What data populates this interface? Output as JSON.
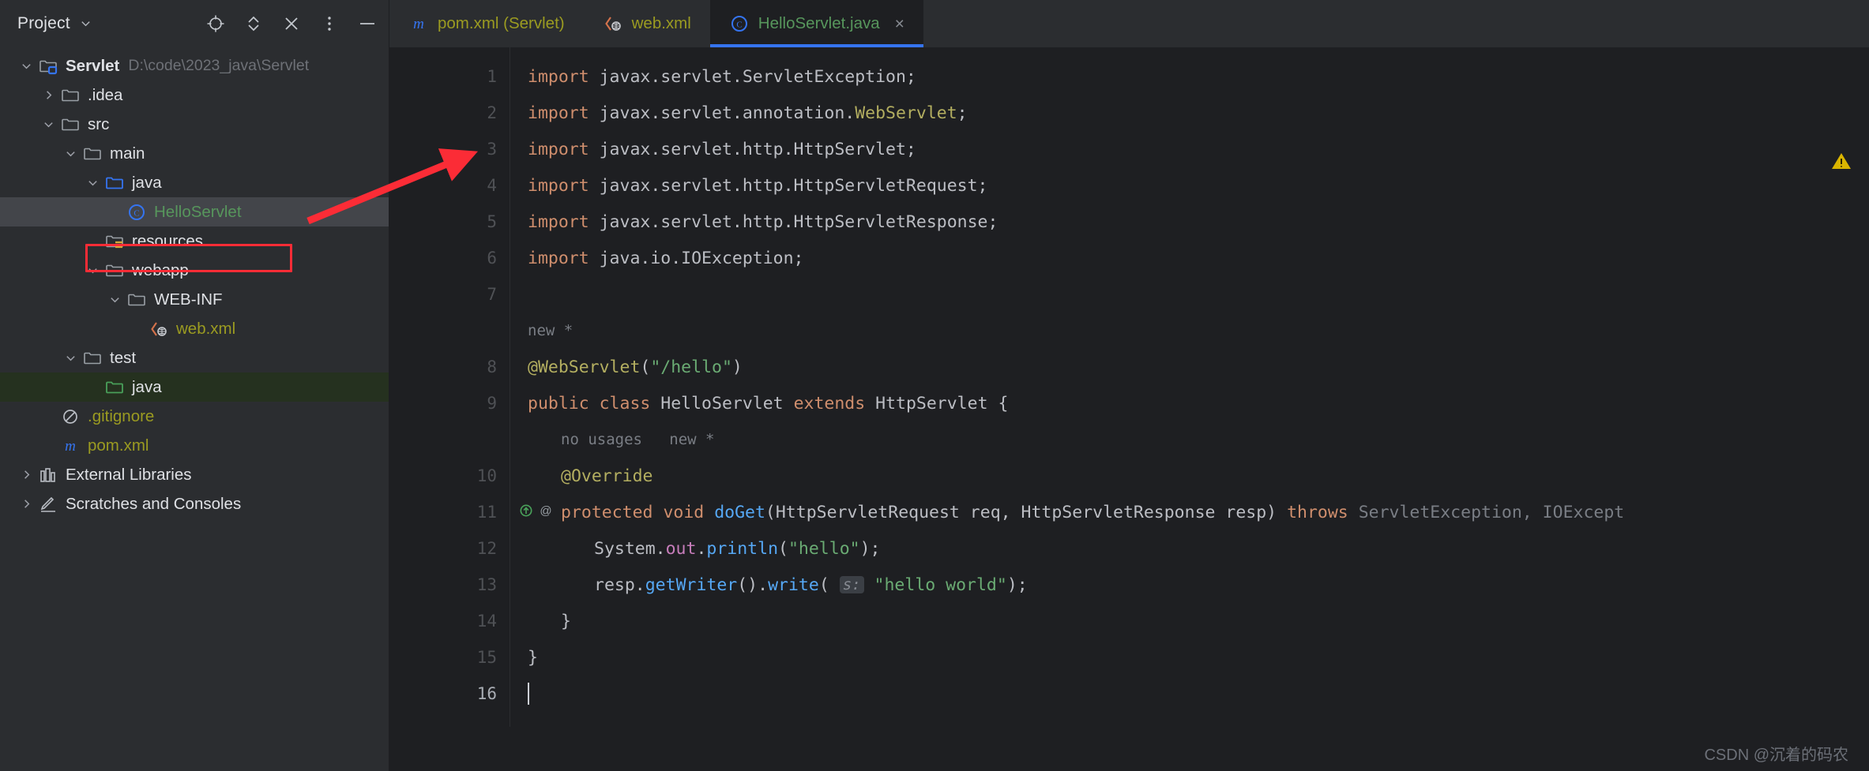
{
  "panel": {
    "title": "Project",
    "tools": [
      "locate-icon",
      "expand-collapse-icon",
      "close-icon",
      "more-options-icon",
      "minimize-icon"
    ]
  },
  "tree": [
    {
      "label": "Servlet",
      "path": "D:\\code\\2023_java\\Servlet",
      "icon": "module-folder-icon",
      "arrow": "down",
      "indent": 0,
      "bold": true,
      "color": "default"
    },
    {
      "label": ".idea",
      "path": "",
      "icon": "folder-icon",
      "arrow": "right",
      "indent": 1,
      "bold": false,
      "color": "default"
    },
    {
      "label": "src",
      "path": "",
      "icon": "folder-icon",
      "arrow": "down",
      "indent": 1,
      "bold": false,
      "color": "default"
    },
    {
      "label": "main",
      "path": "",
      "icon": "folder-icon",
      "arrow": "down",
      "indent": 2,
      "bold": false,
      "color": "default"
    },
    {
      "label": "java",
      "path": "",
      "icon": "source-root-folder-icon",
      "arrow": "down",
      "indent": 3,
      "bold": false,
      "color": "default"
    },
    {
      "label": "HelloServlet",
      "path": "",
      "icon": "java-class-icon",
      "arrow": "none",
      "indent": 4,
      "bold": false,
      "color": "green",
      "selected": true,
      "annotated": true
    },
    {
      "label": "resources",
      "path": "",
      "icon": "resources-folder-icon",
      "arrow": "none",
      "indent": 3,
      "bold": false,
      "color": "default"
    },
    {
      "label": "webapp",
      "path": "",
      "icon": "folder-icon",
      "arrow": "down",
      "indent": 3,
      "bold": false,
      "color": "default"
    },
    {
      "label": "WEB-INF",
      "path": "",
      "icon": "folder-icon",
      "arrow": "down",
      "indent": 4,
      "bold": false,
      "color": "default"
    },
    {
      "label": "web.xml",
      "path": "",
      "icon": "xml-file-icon",
      "arrow": "none",
      "indent": 5,
      "bold": false,
      "color": "olive"
    },
    {
      "label": "test",
      "path": "",
      "icon": "folder-icon",
      "arrow": "down",
      "indent": 2,
      "bold": false,
      "color": "default"
    },
    {
      "label": "java",
      "path": "",
      "icon": "test-root-folder-icon",
      "arrow": "none",
      "indent": 3,
      "bold": false,
      "color": "default",
      "testroot": true
    },
    {
      "label": ".gitignore",
      "path": "",
      "icon": "gitignore-icon",
      "arrow": "none",
      "indent": 1,
      "bold": false,
      "color": "olive"
    },
    {
      "label": "pom.xml",
      "path": "",
      "icon": "maven-icon",
      "arrow": "none",
      "indent": 1,
      "bold": false,
      "color": "olive"
    },
    {
      "label": "External Libraries",
      "path": "",
      "icon": "library-icon",
      "arrow": "right",
      "indent": 0,
      "bold": false,
      "color": "default"
    },
    {
      "label": "Scratches and Consoles",
      "path": "",
      "icon": "scratches-icon",
      "arrow": "right",
      "indent": 0,
      "bold": false,
      "color": "default"
    }
  ],
  "tabs": [
    {
      "label": "pom.xml (Servlet)",
      "icon": "maven-icon",
      "type": "xml",
      "active": false,
      "closable": false
    },
    {
      "label": "web.xml",
      "icon": "xml-file-icon",
      "type": "xml",
      "active": false,
      "closable": false
    },
    {
      "label": "HelloServlet.java",
      "icon": "java-class-icon",
      "type": "java",
      "active": true,
      "closable": true,
      "close_label": "×"
    }
  ],
  "editor": {
    "line_numbers": [
      "1",
      "2",
      "3",
      "4",
      "5",
      "6",
      "7",
      "8",
      "9",
      "10",
      "11",
      "12",
      "13",
      "14",
      "15",
      "16"
    ],
    "current_line": "16",
    "gutter_icons": {
      "line": "11",
      "icons": [
        "override-method-icon",
        "annotation-icon"
      ]
    },
    "code_lines": [
      {
        "n": "1",
        "tokens": [
          {
            "c": "k",
            "t": "import "
          },
          {
            "c": "t",
            "t": "javax.servlet.ServletException;"
          }
        ]
      },
      {
        "n": "2",
        "tokens": [
          {
            "c": "k",
            "t": "import "
          },
          {
            "c": "t",
            "t": "javax.servlet.annotation."
          },
          {
            "c": "a",
            "t": "WebServlet"
          },
          {
            "c": "t",
            "t": ";"
          }
        ]
      },
      {
        "n": "3",
        "tokens": [
          {
            "c": "k",
            "t": "import "
          },
          {
            "c": "t",
            "t": "javax.servlet.http.HttpServlet;"
          }
        ]
      },
      {
        "n": "4",
        "tokens": [
          {
            "c": "k",
            "t": "import "
          },
          {
            "c": "t",
            "t": "javax.servlet.http.HttpServletRequest;"
          }
        ]
      },
      {
        "n": "5",
        "tokens": [
          {
            "c": "k",
            "t": "import "
          },
          {
            "c": "t",
            "t": "javax.servlet.http.HttpServletResponse;"
          }
        ]
      },
      {
        "n": "6",
        "tokens": [
          {
            "c": "k",
            "t": "import "
          },
          {
            "c": "t",
            "t": "java.io.IOException;"
          }
        ]
      },
      {
        "n": "7",
        "tokens": []
      },
      {
        "n": "",
        "hint": true,
        "tokens": [
          {
            "c": "dim",
            "t": "new *"
          }
        ]
      },
      {
        "n": "8",
        "tokens": [
          {
            "c": "a",
            "t": "@WebServlet"
          },
          {
            "c": "t",
            "t": "("
          },
          {
            "c": "s",
            "t": "\"/hello\""
          },
          {
            "c": "t",
            "t": ")"
          }
        ]
      },
      {
        "n": "9",
        "tokens": [
          {
            "c": "k",
            "t": "public class "
          },
          {
            "c": "t",
            "t": "HelloServlet "
          },
          {
            "c": "k",
            "t": "extends "
          },
          {
            "c": "t",
            "t": "HttpServlet {"
          }
        ]
      },
      {
        "n": "",
        "hint": true,
        "indent": 1,
        "tokens": [
          {
            "c": "dim",
            "t": "no usages   new *"
          }
        ]
      },
      {
        "n": "10",
        "indent": 1,
        "tokens": [
          {
            "c": "a",
            "t": "@Override"
          }
        ]
      },
      {
        "n": "11",
        "indent": 1,
        "tokens": [
          {
            "c": "k",
            "t": "protected "
          },
          {
            "c": "k",
            "t": "void "
          },
          {
            "c": "f",
            "t": "doGet"
          },
          {
            "c": "t",
            "t": "(HttpServletRequest req, HttpServletResponse resp) "
          },
          {
            "c": "k",
            "t": "throws "
          },
          {
            "c": "dim",
            "t": "ServletException, IOExcept"
          }
        ]
      },
      {
        "n": "12",
        "indent": 2,
        "tokens": [
          {
            "c": "t",
            "t": "System."
          },
          {
            "c": "fi",
            "t": "out"
          },
          {
            "c": "t",
            "t": "."
          },
          {
            "c": "f",
            "t": "println"
          },
          {
            "c": "t",
            "t": "("
          },
          {
            "c": "s",
            "t": "\"hello\""
          },
          {
            "c": "t",
            "t": ");"
          }
        ]
      },
      {
        "n": "13",
        "indent": 2,
        "tokens": [
          {
            "c": "t",
            "t": "resp."
          },
          {
            "c": "f",
            "t": "getWriter"
          },
          {
            "c": "t",
            "t": "()."
          },
          {
            "c": "f",
            "t": "write"
          },
          {
            "c": "t",
            "t": "( "
          },
          {
            "c": "ph",
            "t": "s:"
          },
          {
            "c": "t",
            "t": " "
          },
          {
            "c": "s",
            "t": "\"hello world\""
          },
          {
            "c": "t",
            "t": ");"
          }
        ]
      },
      {
        "n": "14",
        "indent": 1,
        "tokens": [
          {
            "c": "t",
            "t": "}"
          }
        ]
      },
      {
        "n": "15",
        "tokens": [
          {
            "c": "t",
            "t": "}"
          }
        ]
      },
      {
        "n": "16",
        "caret": true,
        "tokens": []
      }
    ]
  },
  "status": {
    "warning_icon": "warning-triangle-icon"
  },
  "watermark": "CSDN @沉着的码农",
  "colors": {
    "panel_bg": "#2b2d30",
    "editor_bg": "#1e1f22",
    "accent": "#3574f0",
    "annotation_red": "#fb2c36",
    "keyword": "#cf8e6d",
    "string": "#6aab73",
    "annotation_yellow": "#b3ae60",
    "method": "#56a8f5",
    "test_root_bg": "#25311f",
    "selection_bg": "#43454a"
  }
}
